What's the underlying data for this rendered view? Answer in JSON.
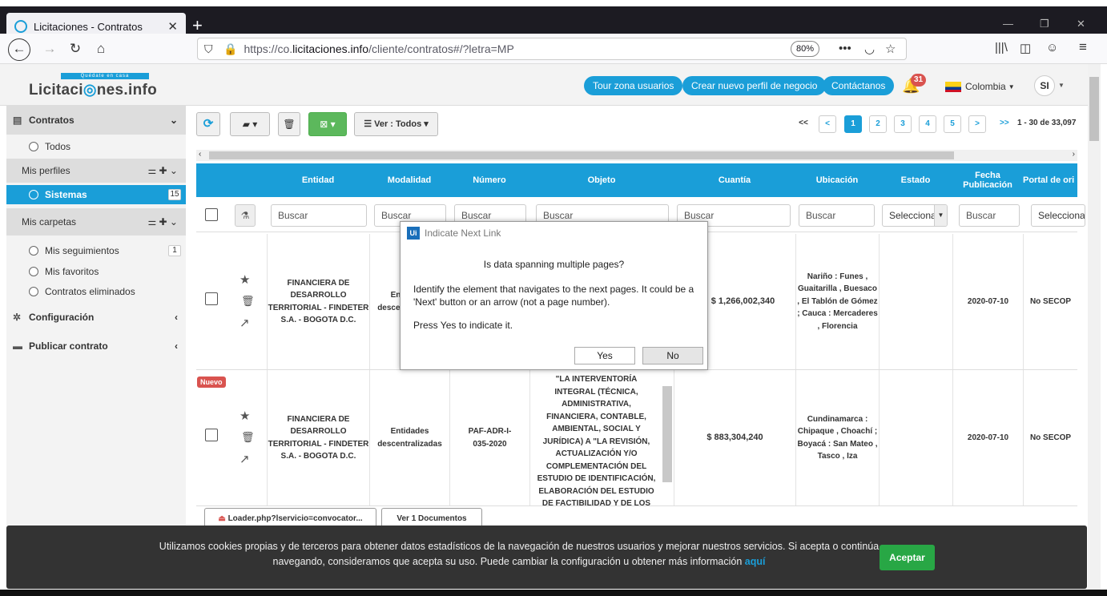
{
  "browser": {
    "tab_title": "Licitaciones - Contratos",
    "url_pre": "https://co.",
    "url_host": "licitaciones.info",
    "url_path": "/cliente/contratos#/?letra=MP",
    "zoom": "80%"
  },
  "header": {
    "logo_tag": "Quédate en casa",
    "logo_text_a": "Licitaci",
    "logo_text_b": "nes.info",
    "buttons": [
      "Tour zona usuarios",
      "Crear nuevo perfil de negocio",
      "Contáctanos"
    ],
    "notifications": "31",
    "country": "Colombia",
    "user_initials": "SI"
  },
  "sidebar": {
    "contratos": "Contratos",
    "todos": "Todos",
    "mis_perfiles": "Mis perfiles",
    "sistemas": "Sistemas",
    "sistemas_count": "15",
    "mis_carpetas": "Mis carpetas",
    "mis_seguimientos": "Mis seguimientos",
    "seguimientos_count": "1",
    "mis_favoritos": "Mis favoritos",
    "contratos_eliminados": "Contratos eliminados",
    "configuracion": "Configuración",
    "publicar_contrato": "Publicar contrato"
  },
  "toolbar": {
    "ver_label": "Ver : Todos"
  },
  "pagination": {
    "first": "<<",
    "prev": "<",
    "pages": [
      "1",
      "2",
      "3",
      "4",
      "5"
    ],
    "next": ">",
    "last": ">>",
    "info": "1 - 30 de 33,097"
  },
  "table": {
    "headers": {
      "entidad": "Entidad",
      "modalidad": "Modalidad",
      "numero": "Número",
      "objeto": "Objeto",
      "cuantia": "Cuantía",
      "ubicacion": "Ubicación",
      "estado": "Estado",
      "fecha": "Fecha Publicación",
      "portal": "Portal de ori"
    },
    "filter_placeholder": "Buscar",
    "select_placeholder": "Selecciona",
    "rows": [
      {
        "entidad": "FINANCIERA DE DESARROLLO TERRITORIAL - FINDETER S.A. - BOGOTA D.C.",
        "modalidad": "Entidades descentralizadas",
        "cuantia": "$ 1,266,002,340",
        "ubicacion": "Nariño : Funes , Guaitarilla , Buesaco , El Tablón de Gómez ; Cauca : Mercaderes , Florencia",
        "fecha": "2020-07-10",
        "portal": "No SECOP"
      },
      {
        "badge": "Nuevo",
        "entidad": "FINANCIERA DE DESARROLLO TERRITORIAL - FINDETER S.A. - BOGOTA D.C.",
        "modalidad": "Entidades descentralizadas",
        "numero": "PAF-ADR-I-035-2020",
        "objeto": "\"LA INTERVENTORÍA INTEGRAL (TÉCNICA, ADMINISTRATIVA, FINANCIERA, CONTABLE, AMBIENTAL, SOCIAL Y JURÍDICA) A \"LA REVISIÓN, ACTUALIZACIÓN Y/O COMPLEMENTACIÓN DEL ESTUDIO DE IDENTIFICACIÓN, ELABORACIÓN DEL ESTUDIO DE FACTIBILIDAD Y DE LOS",
        "cuantia": "$ 883,304,240",
        "ubicacion": "Cundinamarca : Chipaque , Choachí ; Boyacá : San Mateo , Tasco , Iza",
        "fecha": "2020-07-10",
        "portal": "No SECOP"
      }
    ],
    "file_button": "Loader.php?lservicio=convocator...",
    "docs_button": "Ver 1 Documentos"
  },
  "dialog": {
    "title": "Indicate Next Link",
    "question": "Is data spanning multiple pages?",
    "body": "Identify the element that navigates to the next pages. It could be a 'Next' button or an arrow (not a page number).",
    "body2": "Press Yes to indicate it.",
    "yes": "Yes",
    "no": "No"
  },
  "cookie": {
    "text": "Utilizamos cookies propias y de terceros para obtener datos estadísticos de la navegación de nuestros usuarios y mejorar nuestros servicios. Si acepta o continúa navegando, consideramos que acepta su uso. Puede cambiar la configuración u obtener más información",
    "link": "aquí",
    "accept": "Aceptar"
  }
}
